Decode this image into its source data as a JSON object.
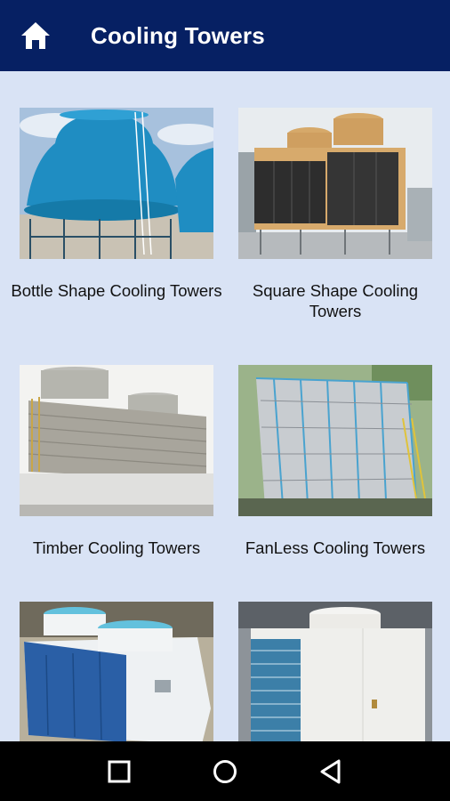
{
  "appbar": {
    "title": "Cooling Towers",
    "home_icon": "home-icon"
  },
  "products": [
    {
      "name": "Bottle Shape Cooling Towers",
      "image": "bottle-tower-image"
    },
    {
      "name": "Square Shape Cooling Towers",
      "image": "square-tower-image"
    },
    {
      "name": "Timber Cooling Towers",
      "image": "timber-tower-image"
    },
    {
      "name": "FanLess Cooling Towers",
      "image": "fanless-tower-image"
    },
    {
      "name": "",
      "image": "frp-tower-image"
    },
    {
      "name": "",
      "image": "crossflow-tower-image"
    }
  ],
  "navbar": {
    "back_icon": "back-triangle-icon",
    "home_icon": "home-circle-icon",
    "recents_icon": "recents-square-icon"
  },
  "colors": {
    "appbar": "#062063",
    "background": "#d9e3f5",
    "navbar": "#000000"
  }
}
